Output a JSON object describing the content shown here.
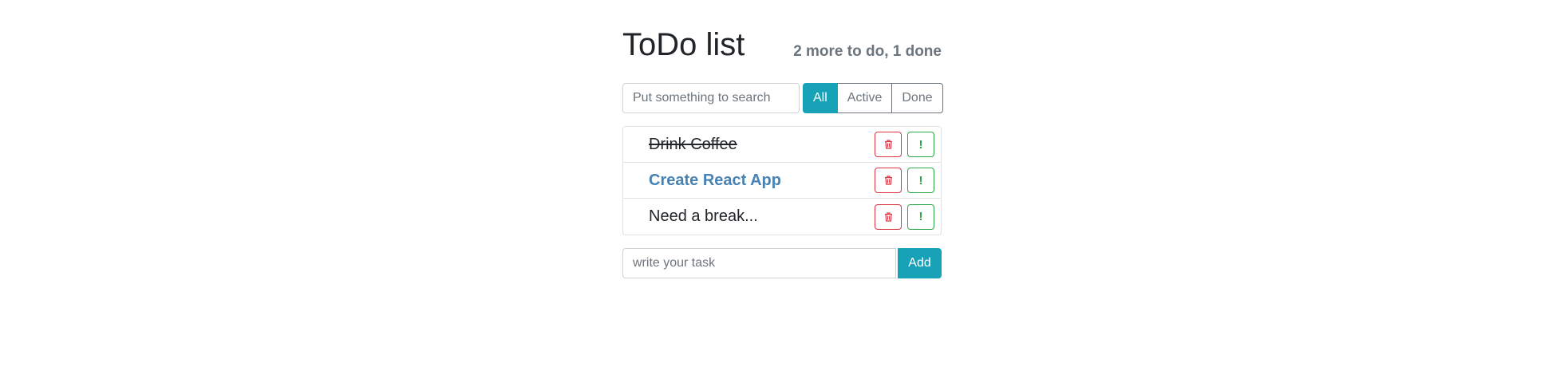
{
  "header": {
    "title": "ToDo list",
    "counter": "2 more to do, 1 done"
  },
  "search": {
    "placeholder": "Put something to search",
    "value": ""
  },
  "filters": [
    {
      "label": "All",
      "active": true
    },
    {
      "label": "Active",
      "active": false
    },
    {
      "label": "Done",
      "active": false
    }
  ],
  "todos": [
    {
      "label": "Drink Coffee",
      "done": true,
      "important": false
    },
    {
      "label": "Create React App",
      "done": false,
      "important": true
    },
    {
      "label": "Need a break...",
      "done": false,
      "important": false
    }
  ],
  "item_buttons": {
    "delete_icon": "trash-icon",
    "important_label": "!"
  },
  "add_form": {
    "placeholder": "write your task",
    "value": "",
    "button_label": "Add"
  },
  "colors": {
    "accent": "#17a2b8",
    "danger": "#dc3545",
    "success": "#28a745",
    "important_text": "#4682b4"
  }
}
